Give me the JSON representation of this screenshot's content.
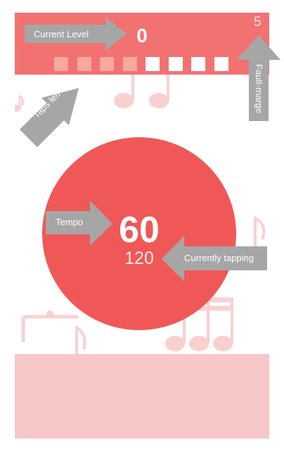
{
  "header": {
    "current_level_value": "0",
    "fault_marge_value": "5",
    "taps": {
      "total": 8,
      "used": 4
    }
  },
  "center": {
    "tempo_value": "60",
    "currently_tapping_value": "120"
  },
  "annotations": {
    "current_level": "Current Level",
    "taps_left": "Taps left",
    "fault_marge": "Fault-marge",
    "tempo": "Tempo",
    "currently_tapping": "Currently tapping"
  },
  "colors": {
    "accent": "#f05858",
    "top_bar": "#f27272",
    "used_square": "#f9a79f",
    "annotation_arrow": "#a6a6a6",
    "bottom_band": "#f7c7c7"
  }
}
